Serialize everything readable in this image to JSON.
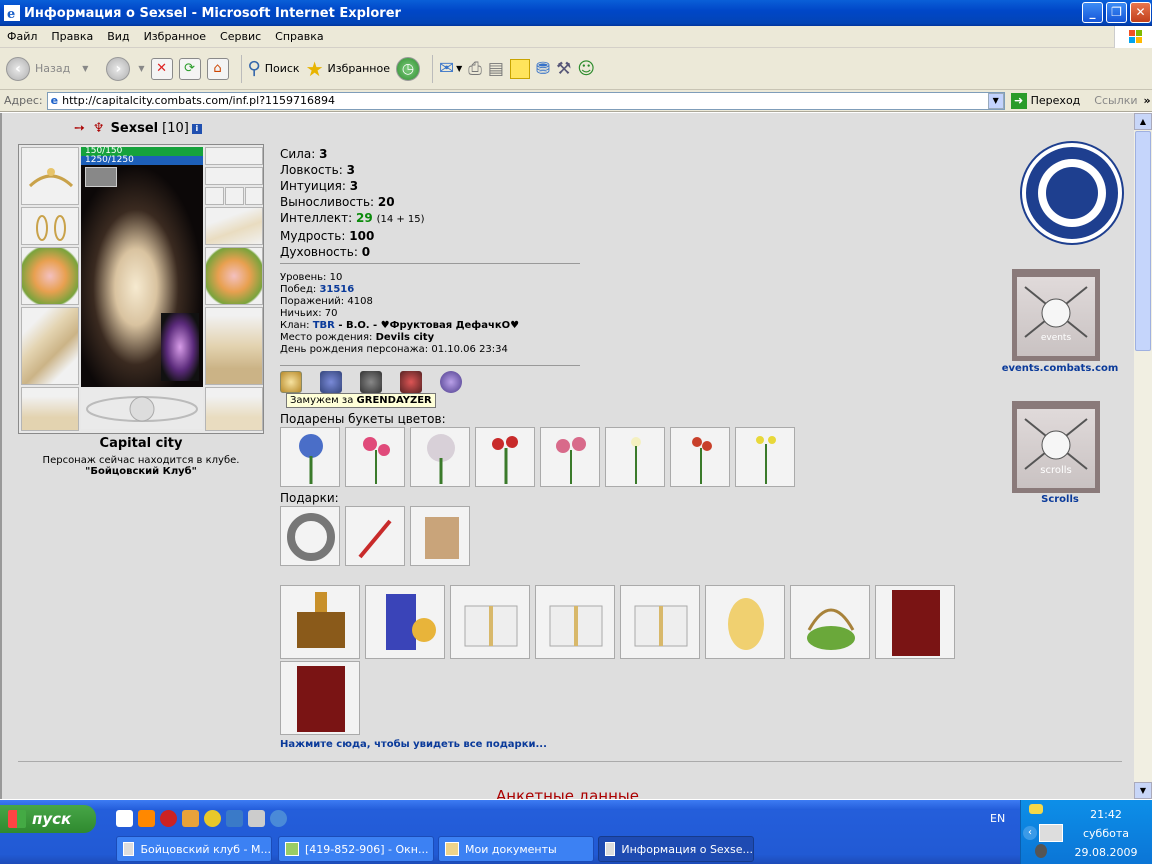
{
  "window": {
    "title": "Информация о Sexsel - Microsoft Internet Explorer",
    "min": "_",
    "max": "❐",
    "close": "✕"
  },
  "menu": [
    "Файл",
    "Правка",
    "Вид",
    "Избранное",
    "Сервис",
    "Справка"
  ],
  "toolbar": {
    "back": "Назад",
    "search": "Поиск",
    "favorites": "Избранное"
  },
  "address": {
    "label": "Адрес:",
    "url": "http://capitalcity.combats.com/inf.pl?1159716894",
    "go": "Переход",
    "links": "Ссылки"
  },
  "character": {
    "name": "Sexsel",
    "level": "[10]",
    "hp": "150/150",
    "mana": "1250/1250",
    "city": "Capital city",
    "location_text": "Персонаж сейчас находится в клубе.",
    "location_name": "\"Бойцовский Клуб\""
  },
  "stats": [
    {
      "label": "Сила:",
      "value": "3"
    },
    {
      "label": "Ловкость:",
      "value": "3"
    },
    {
      "label": "Интуиция:",
      "value": "3"
    },
    {
      "label": "Выносливость:",
      "value": "20"
    },
    {
      "label": "Интеллект:",
      "value": "29",
      "extra": "(14 + 15)"
    },
    {
      "label": "Мудрость:",
      "value": "100"
    },
    {
      "label": "Духовность:",
      "value": "0"
    }
  ],
  "details": {
    "level": "Уровень: 10",
    "wins_label": "Побед:",
    "wins": "31516",
    "losses": "Поражений: 4108",
    "draws": "Ничьих: 70",
    "clan_label": "Клан:",
    "clan": "TBR",
    "clan_rest": " - B.O. - ♥Фруктовая ДефачкО♥",
    "birthplace_label": "Место рождения:",
    "birthplace": "Devils city",
    "birthday": "День рождения персонажа: 01.10.06 23:34"
  },
  "tooltip": {
    "prefix": "Замужем за",
    "name": "GRENDAYZER"
  },
  "sections": {
    "flowers": "Подарены букеты цветов:",
    "gifts": "Подарки:",
    "all_gifts_link": "Нажмите сюда, чтобы увидеть все подарки...",
    "anket": "Анкетные данные"
  },
  "right": {
    "events": "events",
    "events_link": "events.combats.com",
    "scrolls": "scrolls",
    "scrolls_link": "Scrolls"
  },
  "taskbar": {
    "start": "пуск",
    "lang": "EN",
    "time": "21:42",
    "day": "суббота",
    "date": "29.08.2009",
    "tasks": [
      "Бойцовский клуб - M...",
      "[419-852-906] - Окн...",
      "Мои документы",
      "Информация о Sexse..."
    ]
  }
}
